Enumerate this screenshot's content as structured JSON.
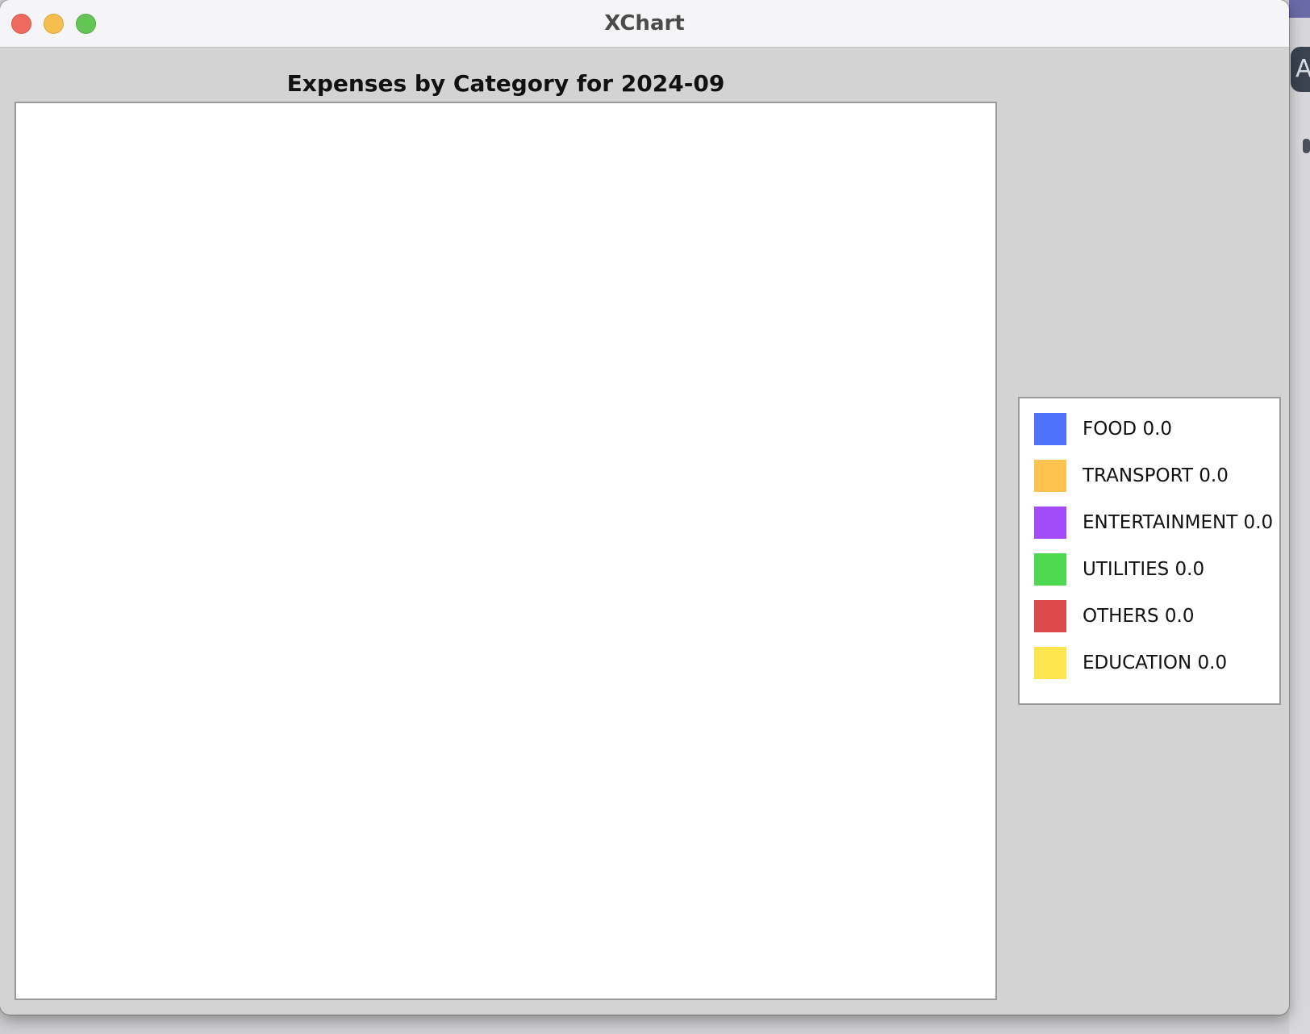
{
  "window": {
    "title": "XChart"
  },
  "desktop": {
    "badge_text": "A"
  },
  "chart_data": {
    "type": "pie",
    "title": "Expenses by Category for 2024-09",
    "legend_position": "right",
    "categories": [
      "FOOD",
      "TRANSPORT",
      "ENTERTAINMENT",
      "UTILITIES",
      "OTHERS",
      "EDUCATION"
    ],
    "values": [
      0.0,
      0.0,
      0.0,
      0.0,
      0.0,
      0.0
    ],
    "colors": [
      "#4e72fb",
      "#fec24f",
      "#a34bf8",
      "#4ed84f",
      "#dc4a4b",
      "#fee44d"
    ],
    "legend_labels": [
      "FOOD 0.0",
      "TRANSPORT 0.0",
      "ENTERTAINMENT 0.0",
      "UTILITIES 0.0",
      "OTHERS 0.0",
      "EDUCATION 0.0"
    ]
  }
}
